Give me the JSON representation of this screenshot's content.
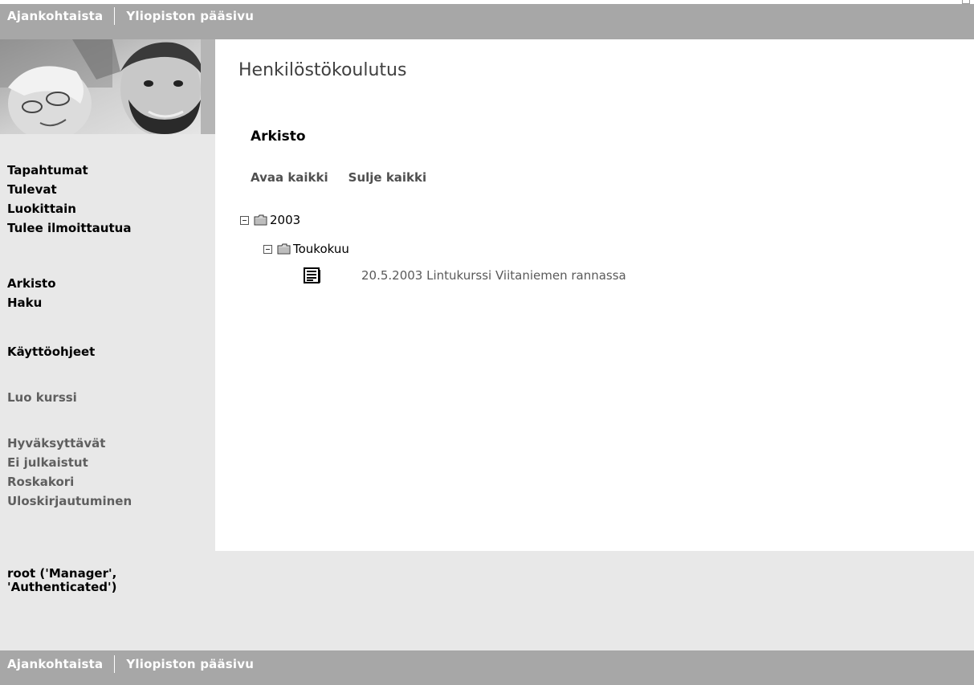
{
  "top_nav": {
    "links": [
      "Ajankohtaista",
      "Yliopiston pääsivu"
    ]
  },
  "bottom_nav": {
    "links": [
      "Ajankohtaista",
      "Yliopiston pääsivu"
    ]
  },
  "sidebar": {
    "groups": [
      [
        "Tapahtumat",
        "Tulevat",
        "Luokittain",
        "Tulee ilmoittautua"
      ],
      [
        "Arkisto",
        "Haku"
      ],
      [
        "Käyttöohjeet"
      ],
      [
        "Luo kurssi"
      ],
      [
        "Hyväksyttävät",
        "Ei julkaistut",
        "Roskakori",
        "Uloskirjautuminen"
      ]
    ]
  },
  "page": {
    "title": "Henkilöstökoulutus",
    "section": "Arkisto",
    "expand_all": "Avaa kaikki",
    "collapse_all": "Sulje kaikki"
  },
  "tree": {
    "year": "2003",
    "month": "Toukokuu",
    "item": "20.5.2003 Lintukurssi Viitaniemen rannassa"
  },
  "user": {
    "info": "root ('Manager',\n'Authenticated')"
  },
  "colors": {
    "bar": "#a7a7a7",
    "sidebar_bg": "#e8e8e8"
  }
}
